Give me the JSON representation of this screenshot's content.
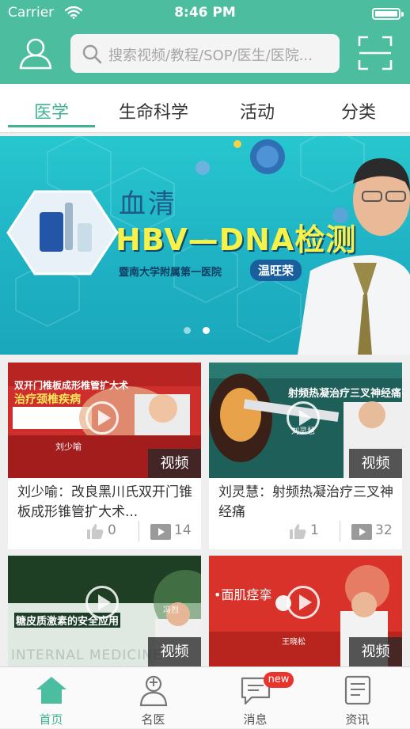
{
  "status_bar": {
    "carrier": "Carrier",
    "time": "8:46 PM"
  },
  "search": {
    "placeholder": "搜索视频/教程/SOP/医生/医院..."
  },
  "tabs": [
    {
      "label": "医学",
      "active": true
    },
    {
      "label": "生命科学",
      "active": false
    },
    {
      "label": "活动",
      "active": false
    },
    {
      "label": "分类",
      "active": false
    }
  ],
  "banner": {
    "title_line1": "血清",
    "title_line2": "HBV—DNA检测",
    "hospital": "暨南大学附属第一医院",
    "doctor": "温旺荣",
    "page_count": 2,
    "current_page": 2
  },
  "cards": [
    {
      "badge": "视频",
      "title": "刘少喻：改良黑川氏双开门锥板成形锥管扩大术...",
      "likes": "0",
      "views": "14"
    },
    {
      "badge": "视频",
      "title": "刘灵慧：射频热凝治疗三叉神经痛",
      "likes": "1",
      "views": "32"
    },
    {
      "badge": "视频",
      "title": "",
      "likes": "",
      "views": ""
    },
    {
      "badge": "视频",
      "title": "",
      "likes": "",
      "views": ""
    }
  ],
  "thumb_text": {
    "card1_line1": "双开门椎板成形椎管扩大术",
    "card1_line2": "治疗颈椎疾病",
    "card1_presenter": "刘少喻",
    "card2_title": "射频热凝治疗三叉神经痛",
    "card2_presenter": "刘灵慧",
    "card3_title": "糖皮质激素的安全应用",
    "card3_presenter": "冯烈",
    "card3_watermark": "INTERNAL MEDICINE",
    "card4_title": "•面肌痉挛",
    "card4_presenter": "王晓松"
  },
  "tabbar": [
    {
      "label": "首页",
      "icon": "home-icon",
      "active": true
    },
    {
      "label": "名医",
      "icon": "doctor-icon",
      "active": false
    },
    {
      "label": "消息",
      "icon": "message-icon",
      "active": false,
      "badge": "new"
    },
    {
      "label": "资讯",
      "icon": "news-icon",
      "active": false
    }
  ],
  "colors": {
    "primary": "#4cbd9e",
    "accent": "#3fb393",
    "badge_red": "#e8342c"
  }
}
